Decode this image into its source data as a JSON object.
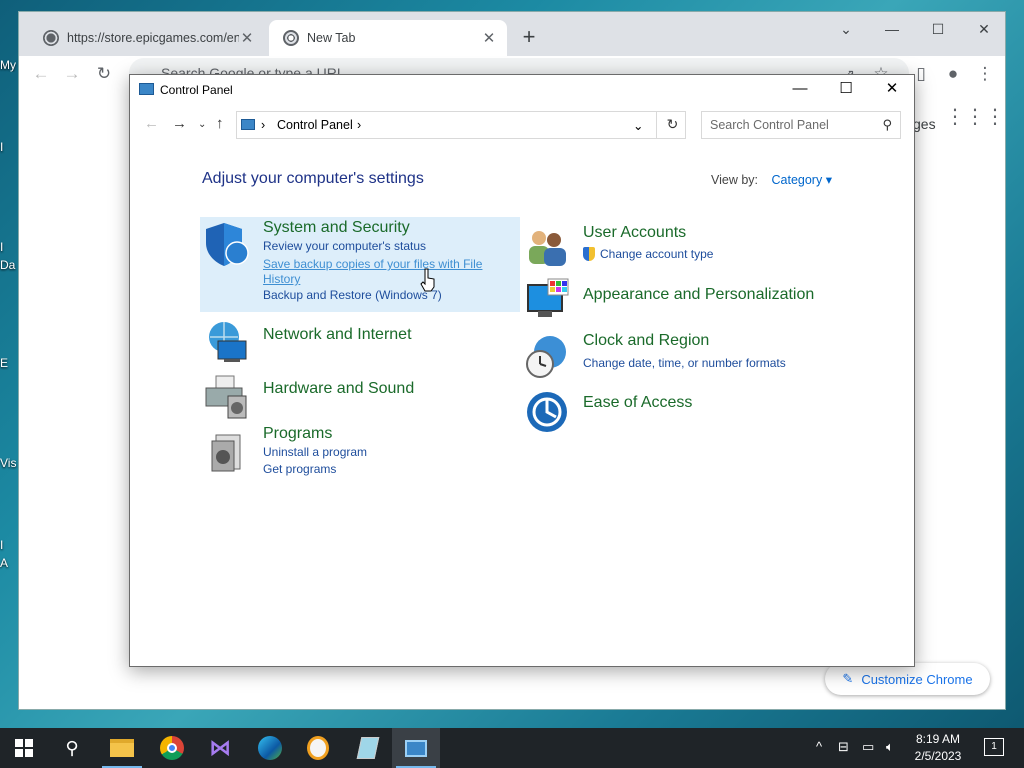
{
  "desktop": {
    "labels": [
      "My",
      "I",
      "Da",
      "I",
      "E",
      "Vis",
      "I",
      "A"
    ]
  },
  "browser": {
    "tabs": [
      {
        "title": "https://store.epicgames.com/en-"
      },
      {
        "title": "New Tab"
      }
    ],
    "omnibox_placeholder": "Search Google or type a URL",
    "partial_link": "ges",
    "customize_label": "Customize Chrome"
  },
  "control_panel": {
    "window_title": "Control Panel",
    "address_segment": "Control Panel",
    "search_placeholder": "Search Control Panel",
    "heading": "Adjust your computer's settings",
    "view_by_label": "View by:",
    "view_by_value": "Category",
    "categories": [
      {
        "title": "System and Security",
        "links": [
          "Review your computer's status",
          "Save backup copies of your files with File",
          "History",
          "Backup and Restore (Windows 7)"
        ]
      },
      {
        "title": "Network and Internet",
        "links": []
      },
      {
        "title": "Hardware and Sound",
        "links": []
      },
      {
        "title": "Programs",
        "links": [
          "Uninstall a program",
          "Get programs"
        ]
      },
      {
        "title": "User Accounts",
        "links": [
          "Change account type"
        ]
      },
      {
        "title": "Appearance and Personalization",
        "links": []
      },
      {
        "title": "Clock and Region",
        "links": [
          "Change date, time, or number formats"
        ]
      },
      {
        "title": "Ease of Access",
        "links": []
      }
    ]
  },
  "taskbar": {
    "time": "8:19 AM",
    "date": "2/5/2023",
    "notification_count": "1"
  }
}
